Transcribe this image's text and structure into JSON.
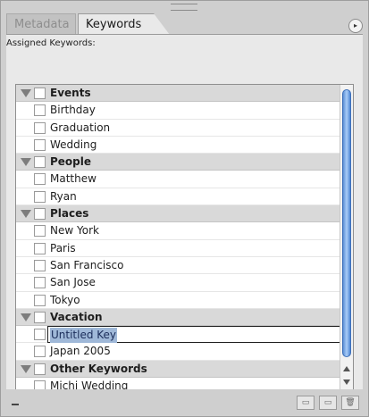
{
  "tabs": [
    {
      "label": "Metadata",
      "active": false
    },
    {
      "label": "Keywords",
      "active": true
    }
  ],
  "panel_menu_icon": "panel-menu-icon",
  "assigned_label": "Assigned Keywords:",
  "keywords": [
    {
      "type": "group",
      "label": "Events"
    },
    {
      "type": "item",
      "label": "Birthday"
    },
    {
      "type": "item",
      "label": "Graduation"
    },
    {
      "type": "item",
      "label": "Wedding"
    },
    {
      "type": "group",
      "label": "People"
    },
    {
      "type": "item",
      "label": "Matthew"
    },
    {
      "type": "item",
      "label": "Ryan"
    },
    {
      "type": "group",
      "label": "Places"
    },
    {
      "type": "item",
      "label": "New York"
    },
    {
      "type": "item",
      "label": "Paris"
    },
    {
      "type": "item",
      "label": "San Francisco"
    },
    {
      "type": "item",
      "label": "San Jose"
    },
    {
      "type": "item",
      "label": "Tokyo"
    },
    {
      "type": "group",
      "label": "Vacation"
    },
    {
      "type": "editing",
      "label": "Untitled Key"
    },
    {
      "type": "item",
      "label": "Japan 2005"
    },
    {
      "type": "group",
      "label": "Other Keywords"
    },
    {
      "type": "item",
      "label": "Michi Wedding"
    }
  ],
  "bottom_buttons": [
    {
      "name": "new-keyword-button",
      "icon": "page-icon"
    },
    {
      "name": "new-sub-keyword-button",
      "icon": "sub-page-icon"
    },
    {
      "name": "delete-keyword-button",
      "icon": "trash-icon"
    }
  ],
  "colors": {
    "panel_bg": "#cfcfcf",
    "list_bg": "#ffffff",
    "group_row_bg": "#d9d9d9",
    "selection_highlight": "#9fb8d8",
    "scroll_thumb": "#5b8fd6"
  }
}
